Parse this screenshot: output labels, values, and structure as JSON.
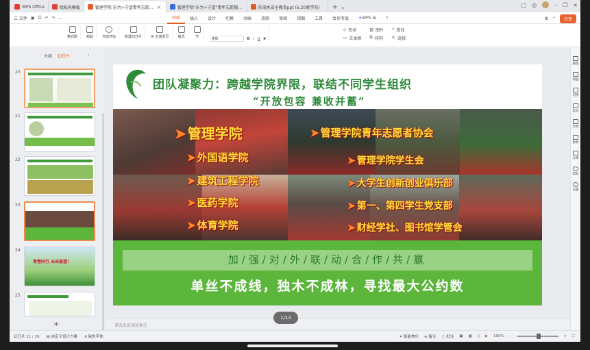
{
  "tabs": [
    {
      "label": "WPS Office",
      "color": "#e33b2e"
    },
    {
      "label": "找稻壳模板",
      "color": "#e0443a"
    },
    {
      "label": "管理学院 乐为+守望青年志愿...",
      "color": "#e05e26",
      "active": true
    },
    {
      "label": "管理学院\"乐为+守望\"青年志愿服...",
      "color": "#3b6de0"
    },
    {
      "label": "防溺水安全教育ppt (6.20就学前)",
      "color": "#e05e26"
    }
  ],
  "menu": {
    "file": "三 文件",
    "items": [
      "开始",
      "插入",
      "设计",
      "切换",
      "动画",
      "放映",
      "审阅",
      "视图",
      "工具",
      "会员专享"
    ],
    "active": "开始",
    "wps_ai": "WPS AI",
    "share": "分享"
  },
  "ribbon": {
    "groups": [
      "格式刷",
      "粘贴",
      "当前开始",
      "新建幻灯片",
      "AI 生成单页",
      "版式",
      "节"
    ],
    "text_tools": [
      "宋体",
      "B",
      "I",
      "U",
      "S"
    ],
    "right_tools": [
      "形状",
      "图片",
      "文本框",
      "排列",
      "查找",
      "替换",
      "选择"
    ]
  },
  "panel": {
    "tabs": [
      "大纲",
      "幻灯片"
    ],
    "active_tab": "幻灯片",
    "slide_numbers": [
      "20",
      "21",
      "22",
      "23",
      "24",
      "25"
    ],
    "thumb24_text": "青春同行 未来展望!",
    "selected": "23"
  },
  "slide": {
    "title1": "团队凝聚力：跨越学院界限，联结不同学生组织",
    "title2": "“开放包容 兼收并蓄”",
    "orgs_left": [
      "管理学院",
      "外国语学院",
      "建筑工程学院",
      "医药学院",
      "体育学院"
    ],
    "orgs_right": [
      "管理学院青年志愿者协会",
      "管理学院学生会",
      "大学生创新创业俱乐部",
      "第一、第四学生党支部",
      "财经学社、图书馆学管会"
    ],
    "band1": "加/强/对/外/联/动/合/作/共/赢",
    "band2": "单丝不成线，独木不成林，寻找最大公约数"
  },
  "notes": "单击此处添加备注",
  "page_indicator": "1/14",
  "rightbar": [
    "属性",
    "动画",
    "切换",
    "美化",
    "文档",
    "素材",
    "文库",
    "帮助",
    "设置"
  ],
  "status": {
    "slide_pos": "幻灯片 21 / 26",
    "theme": "自定义设计方案",
    "font_check": "缺失字体",
    "smart": "智能美化",
    "notes": "备注",
    "comments": "批注",
    "zoom": "100%"
  },
  "colors": {
    "accent": "#e05e26",
    "title_green": "#2f8a3a",
    "band_green": "#5bb63b",
    "org_yellow": "#ffe23a"
  }
}
